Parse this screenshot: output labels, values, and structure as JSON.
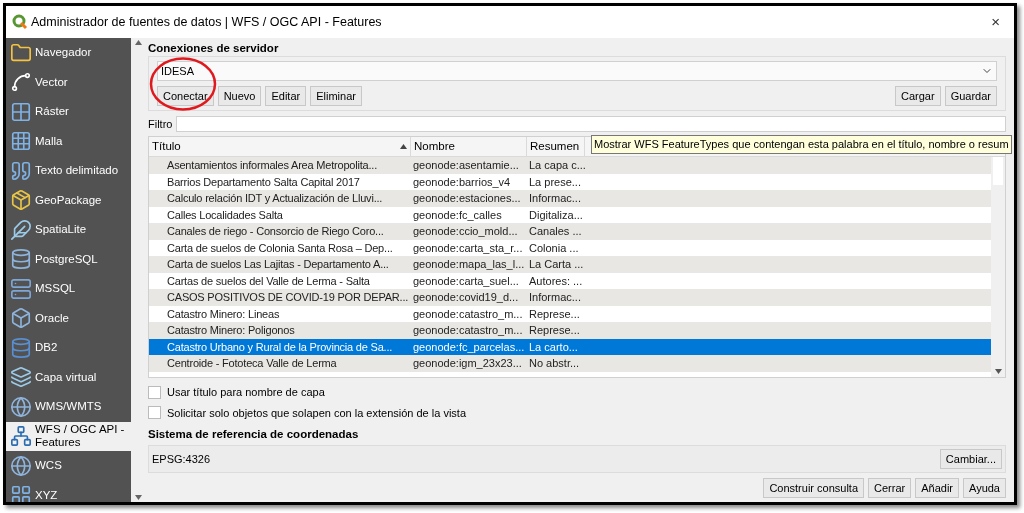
{
  "window": {
    "title": "Administrador de fuentes de datos | WFS / OGC API - Features",
    "close": "×"
  },
  "sidebar": {
    "items": [
      {
        "label": "Navegador",
        "selected": false
      },
      {
        "label": "Vector",
        "selected": false
      },
      {
        "label": "Ráster",
        "selected": false
      },
      {
        "label": "Malla",
        "selected": false
      },
      {
        "label": "Texto delimitado",
        "selected": false
      },
      {
        "label": "GeoPackage",
        "selected": false
      },
      {
        "label": "SpatiaLite",
        "selected": false
      },
      {
        "label": "PostgreSQL",
        "selected": false
      },
      {
        "label": "MSSQL",
        "selected": false
      },
      {
        "label": "Oracle",
        "selected": false
      },
      {
        "label": "DB2",
        "selected": false
      },
      {
        "label": "Capa virtual",
        "selected": false
      },
      {
        "label": "WMS/WMTS",
        "selected": false
      },
      {
        "label": "WFS / OGC API - Features",
        "selected": true
      },
      {
        "label": "WCS",
        "selected": false
      },
      {
        "label": "XYZ",
        "selected": false
      }
    ]
  },
  "connections": {
    "heading": "Conexiones de servidor",
    "selected": "IDESA",
    "buttons": [
      "Conectar",
      "Nuevo",
      "Editar",
      "Eliminar"
    ],
    "right_buttons": [
      "Cargar",
      "Guardar"
    ]
  },
  "filter": {
    "label": "Filtro"
  },
  "tooltip": "Mostrar WFS FeatureTypes que contengan esta palabra en el título, nombre o resum",
  "table": {
    "columns": [
      "Título",
      "Nombre",
      "Resumen"
    ],
    "rows": [
      {
        "cells": [
          "Asentamientos informales  Area Metropolita...",
          "geonode:asentamie...",
          "La capa c..."
        ],
        "selected": false
      },
      {
        "cells": [
          "Barrios Departamento Salta Capital 2017",
          "geonode:barrios_v4",
          "La prese..."
        ],
        "selected": false
      },
      {
        "cells": [
          "Calculo relación IDT  y  Actualización de Lluvi...",
          "geonode:estaciones...",
          "Informac..."
        ],
        "selected": false
      },
      {
        "cells": [
          "Calles Localidades Salta",
          "geonode:fc_calles",
          "Digitaliza..."
        ],
        "selected": false
      },
      {
        "cells": [
          "Canales de riego  - Consorcio de Riego Coro...",
          "geonode:ccio_mold...",
          "Canales ..."
        ],
        "selected": false
      },
      {
        "cells": [
          "Carta de suelos de Colonia Santa Rosa – Dep...",
          "geonode:carta_sta_r...",
          "Colonia ..."
        ],
        "selected": false
      },
      {
        "cells": [
          "Carta de suelos Las Lajitas - Departamento A...",
          "geonode:mapa_las_l...",
          "La Carta ..."
        ],
        "selected": false
      },
      {
        "cells": [
          "Cartas de suelos del Valle de Lerma - Salta",
          "geonode:carta_suel...",
          "Autores: ..."
        ],
        "selected": false
      },
      {
        "cells": [
          "CASOS POSITIVOS DE COVID-19 POR DEPAR...",
          "geonode:covid19_d...",
          "Informac..."
        ],
        "selected": false
      },
      {
        "cells": [
          "Catastro Minero: Lineas",
          "geonode:catastro_m...",
          "Represe..."
        ],
        "selected": false
      },
      {
        "cells": [
          "Catastro Minero: Poligonos",
          "geonode:catastro_m...",
          "Represe..."
        ],
        "selected": false
      },
      {
        "cells": [
          "Catastro Urbano y Rural de la Provincia de Sa...",
          "geonode:fc_parcelas...",
          "La carto..."
        ],
        "selected": true
      },
      {
        "cells": [
          "Centroide - Fototeca Valle de Lerma",
          "geonode:igm_23x23...",
          "No abstr..."
        ],
        "selected": false
      }
    ]
  },
  "options": [
    {
      "label": "Usar título para nombre de capa",
      "checked": false
    },
    {
      "label": "Solicitar solo objetos que solapen con la extensión de la vista",
      "checked": false
    }
  ],
  "crs": {
    "heading": "Sistema de referencia de coordenadas",
    "value": "EPSG:4326",
    "button": "Cambiar..."
  },
  "footer_buttons": [
    "Construir consulta",
    "Cerrar",
    "Añadir",
    "Ayuda"
  ]
}
